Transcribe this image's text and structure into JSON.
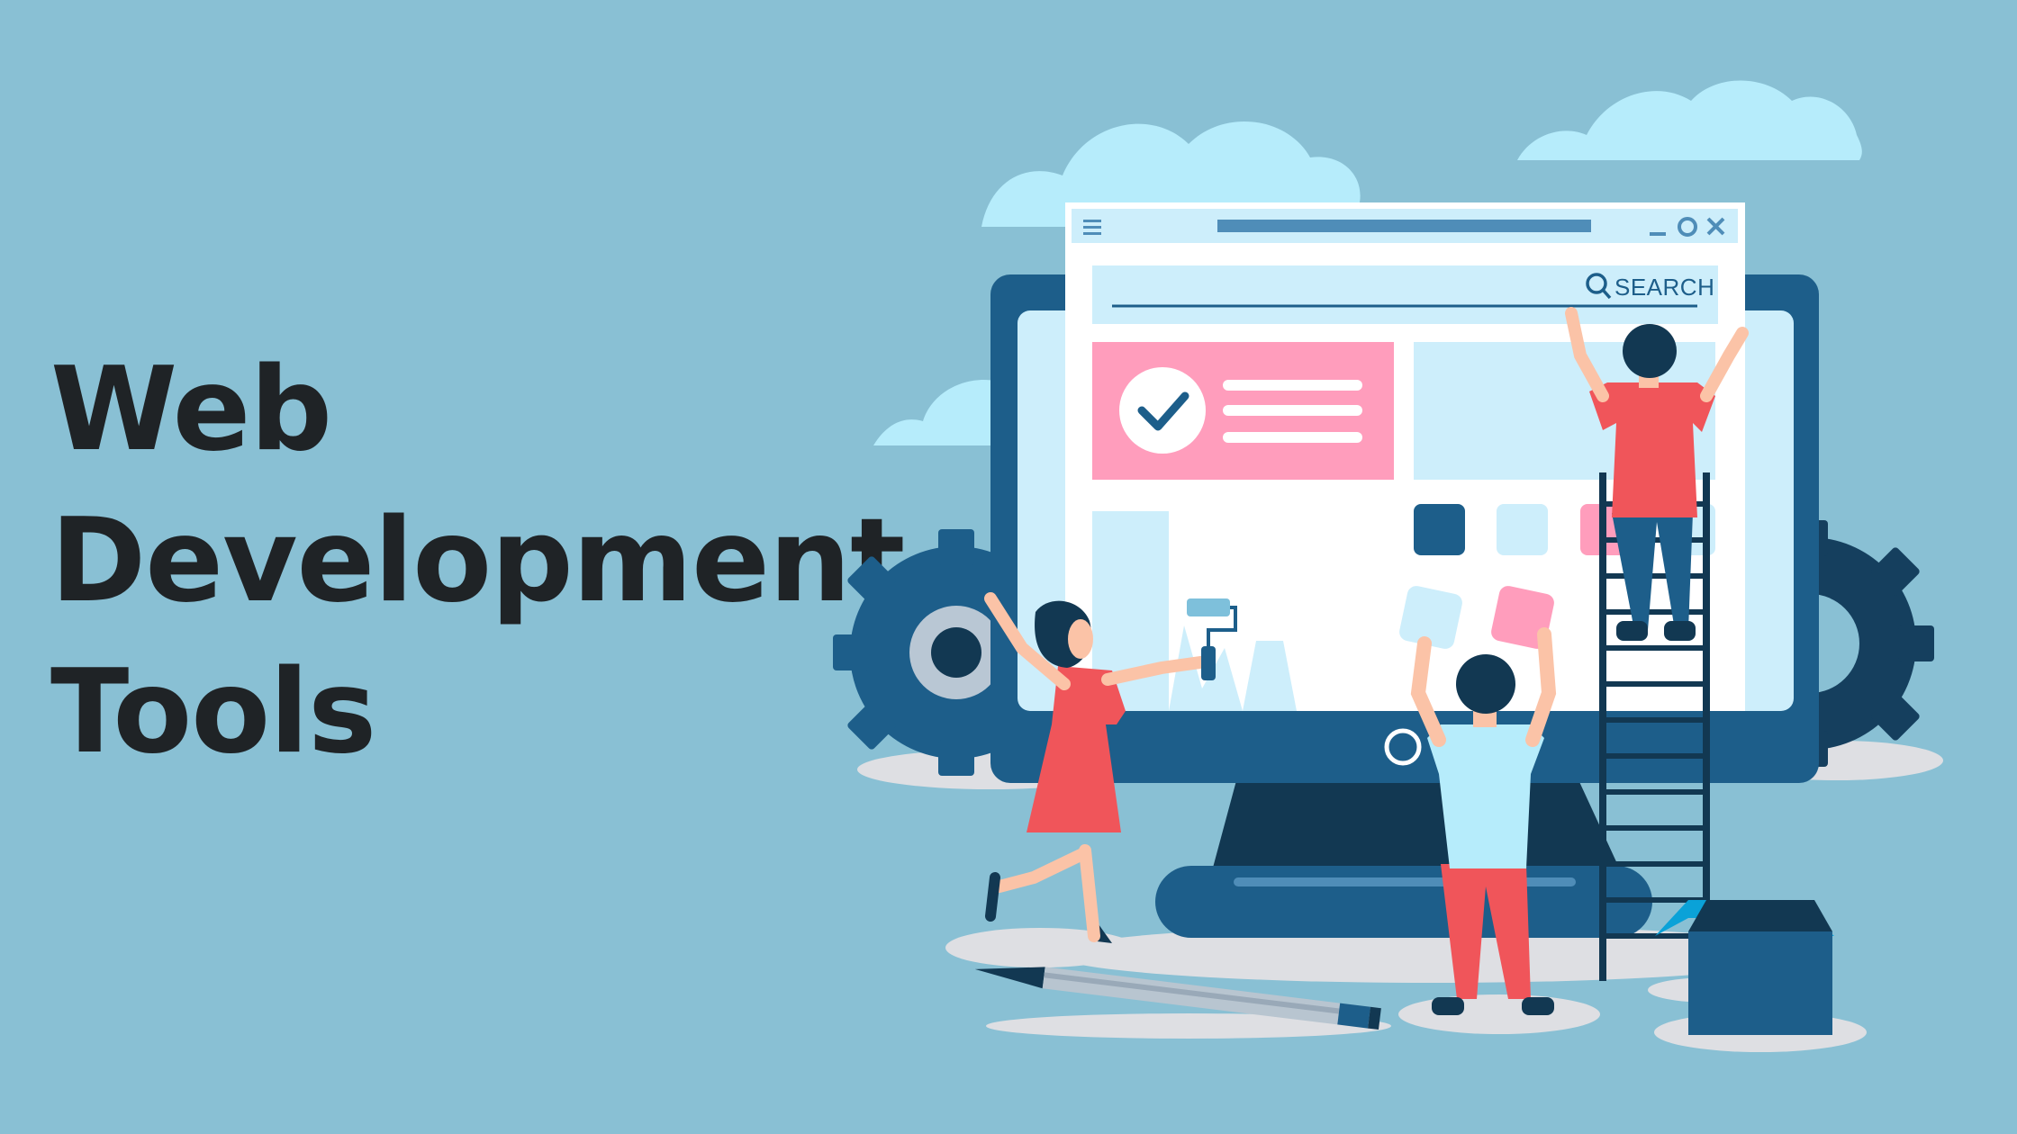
{
  "title": {
    "line1": "Web",
    "line2": "Development",
    "line3": "Tools"
  },
  "illustration": {
    "search_label": "SEARCH",
    "icons": [
      "search-icon",
      "check-icon",
      "menu-icon",
      "minimize-icon",
      "maximize-icon",
      "close-icon",
      "gear-icon",
      "paint-roller-icon",
      "pencil-icon",
      "box-icon",
      "ladder-icon"
    ],
    "colors": {
      "background": "#89c0d4",
      "monitor": "#1d5e8a",
      "monitor_dark": "#153f5e",
      "cloud": "#b6ecfb",
      "pink": "#ff9dbc",
      "screen": "#ffffff",
      "screen_light": "#cdeefb",
      "red_accent": "#f0555a"
    }
  }
}
